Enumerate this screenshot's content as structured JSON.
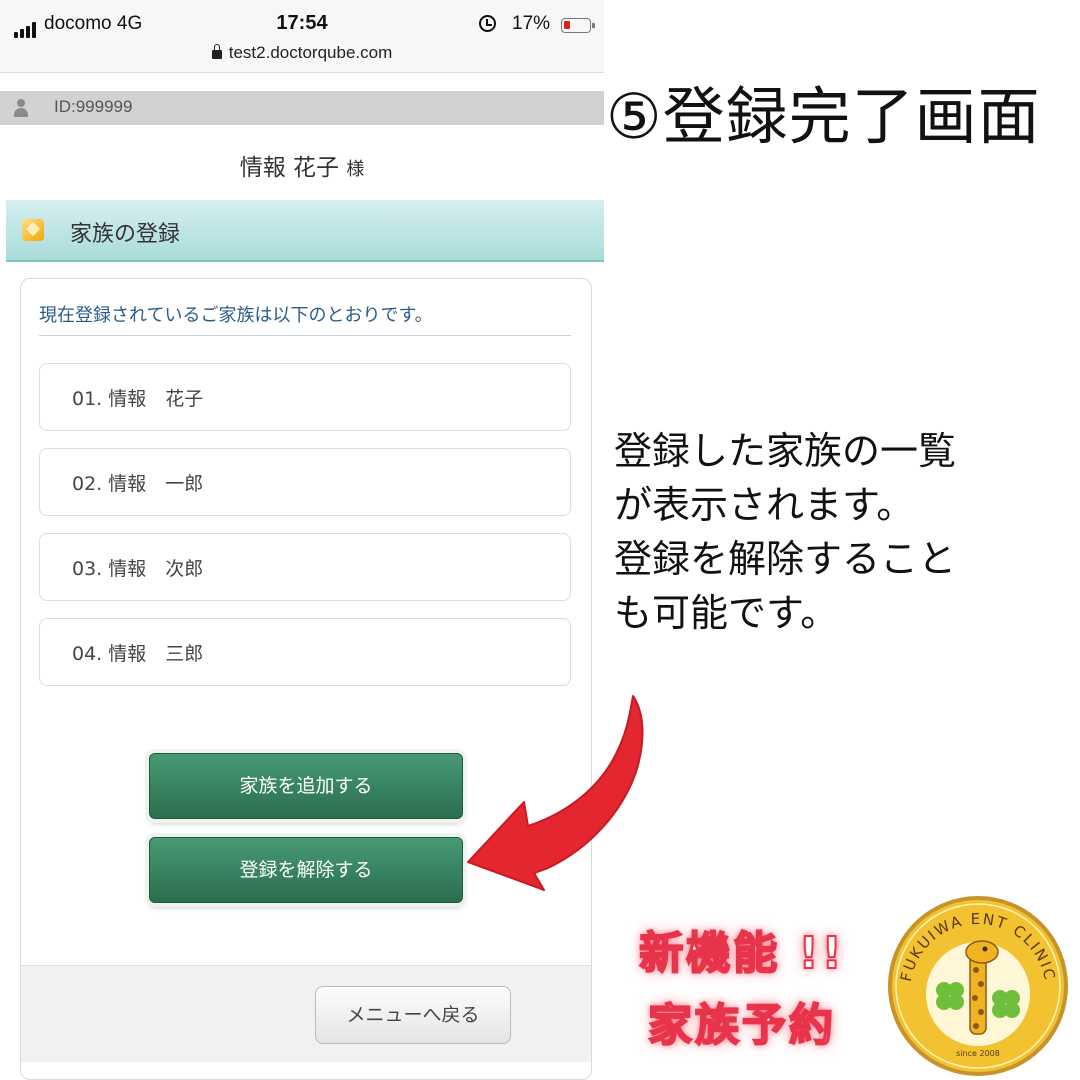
{
  "status_bar": {
    "carrier": "docomo  4G",
    "time": "17:54",
    "battery": "17%",
    "url": "test2.doctorqube.com"
  },
  "id_bar": {
    "user_id": "ID:999999"
  },
  "user": {
    "name": "情報 花子",
    "honorific": "様"
  },
  "section": {
    "title": "家族の登録"
  },
  "intro": "現在登録されているご家族は以下のとおりです。",
  "members": [
    {
      "label": "01. 情報　花子"
    },
    {
      "label": "02. 情報　一郎"
    },
    {
      "label": "03. 情報　次郎"
    },
    {
      "label": "04. 情報　三郎"
    }
  ],
  "buttons": {
    "add_family": "家族を追加する",
    "unregister": "登録を解除する",
    "back_to_menu": "メニューへ戻る"
  },
  "annotation": {
    "step_title": "⑤登録完了画面",
    "description": [
      " 登録した家族の一覧",
      "が表示されます。",
      "登録を解除すること",
      "も可能です。"
    ],
    "promo": [
      "新機能 !!",
      "家族予約"
    ]
  },
  "logo": {
    "text": "FUKUIWA ENT CLINIC",
    "since": "since 2008"
  },
  "colors": {
    "header_teal": "#a9dcda",
    "button_green": "#2f7a55",
    "arrow_red": "#e3262f",
    "promo_pink": "#e8344b",
    "logo_yellow": "#f2c230"
  },
  "icons": [
    "signal-icon",
    "alarm-icon",
    "battery-icon",
    "lock-icon",
    "user-icon",
    "cube-icon",
    "arrow-icon",
    "giraffe-logo"
  ]
}
